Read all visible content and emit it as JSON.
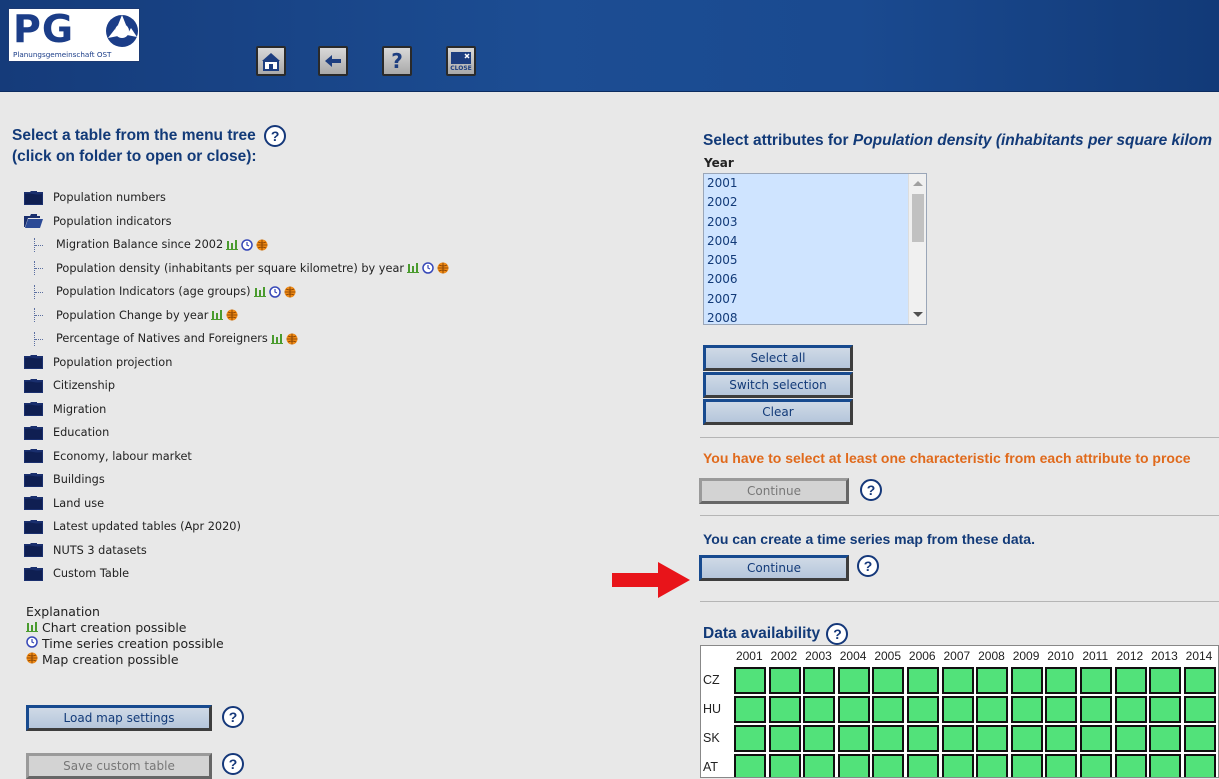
{
  "logo": {
    "text": "PG",
    "subtitle": "Planungsgemeinschaft OST"
  },
  "toolbar": {
    "home_icon": "home-icon",
    "back_icon": "back-arrow-icon",
    "help_label": "?",
    "close_label": "CLOSE"
  },
  "left": {
    "heading_line1": "Select a table from the menu tree",
    "heading_line2": "(click on folder to open or close):",
    "tree": [
      {
        "label": "Population numbers",
        "type": "folder",
        "open": false
      },
      {
        "label": "Population indicators",
        "type": "folder",
        "open": true
      },
      {
        "label": "Migration Balance since 2002",
        "type": "table",
        "icons": [
          "chart",
          "time",
          "map"
        ]
      },
      {
        "label": "Population density (inhabitants per square kilometre) by year",
        "type": "table",
        "icons": [
          "chart",
          "time",
          "map"
        ]
      },
      {
        "label": "Population Indicators (age groups)",
        "type": "table",
        "icons": [
          "chart",
          "time",
          "map"
        ]
      },
      {
        "label": "Population Change by year",
        "type": "table",
        "icons": [
          "chart",
          "map"
        ]
      },
      {
        "label": "Percentage of Natives and Foreigners",
        "type": "table",
        "icons": [
          "chart",
          "map"
        ]
      },
      {
        "label": "Population projection",
        "type": "folder",
        "open": false
      },
      {
        "label": "Citizenship",
        "type": "folder",
        "open": false
      },
      {
        "label": "Migration",
        "type": "folder",
        "open": false
      },
      {
        "label": "Education",
        "type": "folder",
        "open": false
      },
      {
        "label": "Economy, labour market",
        "type": "folder",
        "open": false
      },
      {
        "label": "Buildings",
        "type": "folder",
        "open": false
      },
      {
        "label": "Land use",
        "type": "folder",
        "open": false
      },
      {
        "label": "Latest updated tables (Apr 2020)",
        "type": "folder",
        "open": false
      },
      {
        "label": "NUTS 3 datasets",
        "type": "folder",
        "open": false
      },
      {
        "label": "Custom Table",
        "type": "folder",
        "open": false
      }
    ],
    "explanation": {
      "title": "Explanation",
      "chart": "Chart creation possible",
      "time": "Time series creation possible",
      "map": "Map creation possible"
    },
    "load_map_button": "Load map settings",
    "save_custom_button": "Save custom table"
  },
  "right": {
    "heading_prefix": "Select attributes for ",
    "heading_table": "Population density (inhabitants per square kilom",
    "year_label": "Year",
    "years": [
      "2001",
      "2002",
      "2003",
      "2004",
      "2005",
      "2006",
      "2007",
      "2008"
    ],
    "select_all": "Select all",
    "switch_selection": "Switch selection",
    "clear": "Clear",
    "warning": "You have to select at least one characteristic from each attribute to proce",
    "continue_disabled": "Continue",
    "timeseries_msg": "You can create a time series map from these data.",
    "continue": "Continue",
    "data_availability": "Data availability",
    "avail_years": [
      "2001",
      "2002",
      "2003",
      "2004",
      "2005",
      "2006",
      "2007",
      "2008",
      "2009",
      "2010",
      "2011",
      "2012",
      "2013",
      "2014"
    ],
    "avail_rows": [
      "CZ",
      "HU",
      "SK",
      "AT"
    ]
  },
  "colors": {
    "header_blue": "#1c4d93",
    "heading_blue": "#123a78",
    "warning_orange": "#e06a1c",
    "available_green": "#52e27a",
    "arrow_red": "#e8141a"
  }
}
